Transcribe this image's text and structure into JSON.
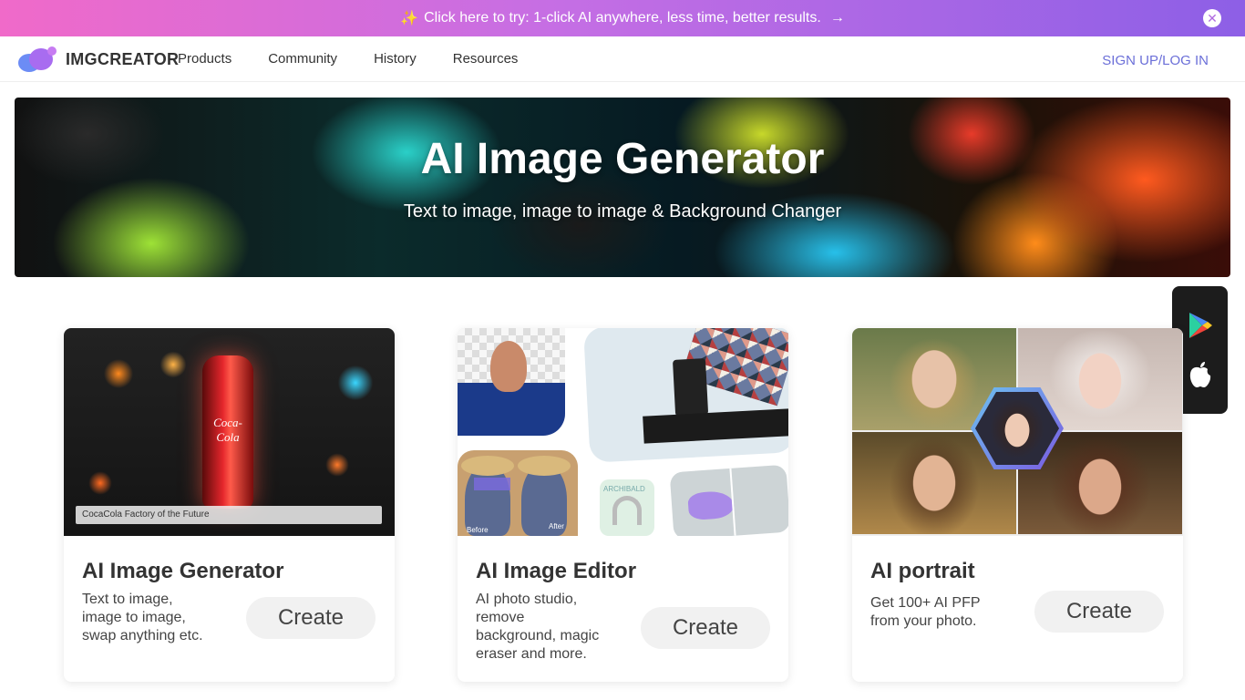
{
  "promo": {
    "text": "Click here to try: 1-click AI anywhere, less time, better results.",
    "spark": "✨",
    "arrow": "→",
    "close": "✕"
  },
  "nav": {
    "logo": "IMGCREATOR",
    "links": [
      "Products",
      "Community",
      "History",
      "Resources"
    ],
    "signup": "SIGN UP/LOG IN"
  },
  "hero": {
    "title": "AI Image Generator",
    "subtitle": "Text to image, image to image & Background Changer"
  },
  "cards": [
    {
      "title": "AI Image Generator",
      "desc": [
        "Text to image,",
        "image to image,",
        "swap anything etc."
      ],
      "button": "Create",
      "caption": "CocaCola Factory of the Future",
      "bottle_text": "Coca-Cola"
    },
    {
      "title": "AI Image Editor",
      "desc": [
        "AI photo studio,",
        "remove",
        "background, magic",
        "eraser and more."
      ],
      "button": "Create",
      "label_before": "Before",
      "label_after": "After",
      "product_label": "ARCHIBALD"
    },
    {
      "title": "AI portrait",
      "desc": [
        "Get 100+ AI PFP",
        "from your photo."
      ],
      "button": "Create"
    }
  ],
  "app_badge": {
    "icons": [
      "google-play-icon",
      "apple-icon"
    ]
  },
  "colors": {
    "promo_start": "#f06ac9",
    "promo_end": "#8d5fe6",
    "signup": "#6b6fd8",
    "button_bg": "#f1f1f1"
  }
}
